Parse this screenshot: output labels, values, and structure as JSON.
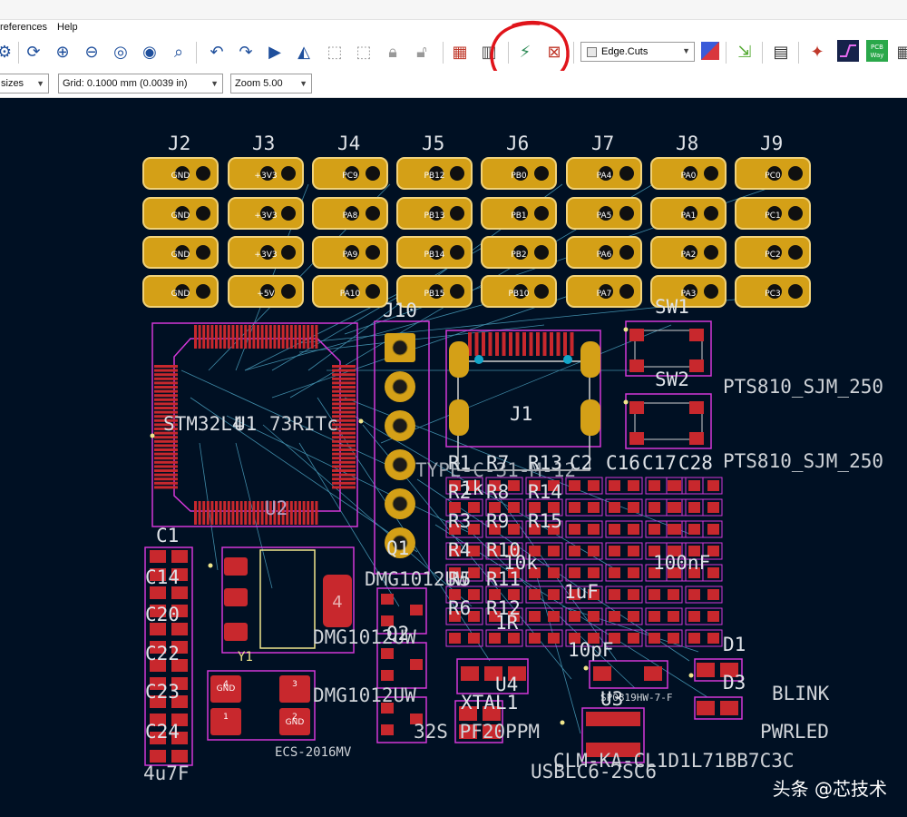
{
  "menu": {
    "items": [
      "references",
      "Help"
    ]
  },
  "toolbar": {
    "layer": "Edge.Cuts",
    "track_sizes": "sizes",
    "grid": "Grid: 0.1000 mm (0.0039 in)",
    "zoom": "Zoom 5.00",
    "pcbway_label": "PCB Way"
  },
  "board": {
    "headers": [
      {
        "ref": "J2",
        "pins": [
          "GND",
          "GND",
          "GND",
          "GND"
        ]
      },
      {
        "ref": "J3",
        "pins": [
          "+3V3",
          "+3V3",
          "+3V3",
          "+5V"
        ]
      },
      {
        "ref": "J4",
        "pins": [
          "PC9",
          "PA8",
          "PA9",
          "PA10"
        ]
      },
      {
        "ref": "J5",
        "pins": [
          "PB12",
          "PB13",
          "PB14",
          "PB15"
        ]
      },
      {
        "ref": "J6",
        "pins": [
          "PB0",
          "PB1",
          "PB2",
          "PB10"
        ]
      },
      {
        "ref": "J7",
        "pins": [
          "PA4",
          "PA5",
          "PA6",
          "PA7"
        ]
      },
      {
        "ref": "J8",
        "pins": [
          "PA0",
          "PA1",
          "PA2",
          "PA3"
        ]
      },
      {
        "ref": "J9",
        "pins": [
          "PC0",
          "PC1",
          "PC2",
          "PC3"
        ]
      }
    ],
    "labels": {
      "j10": "J10",
      "u1": "U1",
      "u1_value": "STM32L4",
      "u1_value_tail": "73RITc",
      "u2": "U2",
      "j1": "J1",
      "sw1": "SW1",
      "sw2": "SW2",
      "sw_value_1": "PTS810_SJM_250",
      "sw_value_2": "PTS810_SJM_250",
      "c1": "C1",
      "c1_val": "C14",
      "c20": "C20",
      "c22": "C22",
      "c23": "C23",
      "c24": "C24",
      "c_value": "4u7F",
      "y1": "Y1",
      "y1_value": "ECS-2016MV",
      "q1": "Q1",
      "q2": "Q2",
      "q_value_1": "DMG1012UW",
      "q_value_2": "DMG1012UW",
      "q_value_3": "DMG1012UW",
      "r_col1": [
        "R1",
        "R2",
        "R3",
        "R4",
        "R5",
        "R6"
      ],
      "r_col2": [
        "R7",
        "R8",
        "R9",
        "R10",
        "R11",
        "R12"
      ],
      "r_col3": [
        "R13",
        "R14",
        "R15"
      ],
      "c_col": [
        "C2",
        "C16",
        "C17",
        "C28"
      ],
      "res_val_1": "1k",
      "res_val_2": "10k",
      "res_val_3": "1R",
      "cap_val_1": "100nF",
      "cap_val_2": "10pF",
      "cap_val_3": "1uF",
      "xtal1": "XTAL1",
      "xtal_value": "32S PF20PPM",
      "u4": "U4",
      "u4_value": "SP0819HW-7-F",
      "u3": "U3",
      "u3_value": "USBLC6-2SC6",
      "d1": "D1",
      "d3": "D3",
      "blink": "BLINK",
      "pwrled": "PWRLED",
      "led_value": "CLM-KA-CL1D1L71BB7C3C",
      "j1_value": "TYPE-C-31-M-12"
    },
    "crystal_pins": [
      "4",
      "3",
      "1",
      "2"
    ],
    "crystal_gnd": "GND",
    "pad_number_4": "4"
  },
  "watermark": "头条 @芯技术",
  "colors": {
    "background": "#001023",
    "pad": "#d4a017",
    "smd": "#c8282d",
    "courtyard": "#d237d8",
    "ratsnest": "#4fa9c8",
    "silk": "#f0e68c",
    "highlight_circle": "#e0141a"
  }
}
